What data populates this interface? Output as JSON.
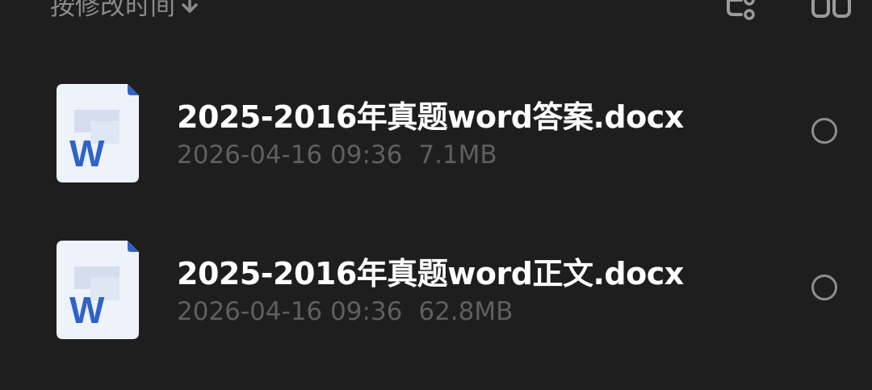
{
  "header": {
    "sort_label": "按修改时间",
    "sort_icon": "arrow-down-icon",
    "tree_icon": "tree-view-icon",
    "grid_icon": "grid-view-icon"
  },
  "files": [
    {
      "name": "2025-2016年真题word答案.docx",
      "date": "2026-04-16 09:36",
      "size": "7.1MB",
      "icon": "word-doc-icon",
      "icon_letter": "W",
      "selected": false
    },
    {
      "name": "2025-2016年真题word正文.docx",
      "date": "2026-04-16 09:36",
      "size": "62.8MB",
      "icon": "word-doc-icon",
      "icon_letter": "W",
      "selected": false
    }
  ],
  "colors": {
    "background": "#1e1e1e",
    "text_primary": "#ffffff",
    "text_secondary": "#5f5f5f",
    "word_blue": "#2f63c9",
    "icon_paper": "#eef2fb"
  }
}
